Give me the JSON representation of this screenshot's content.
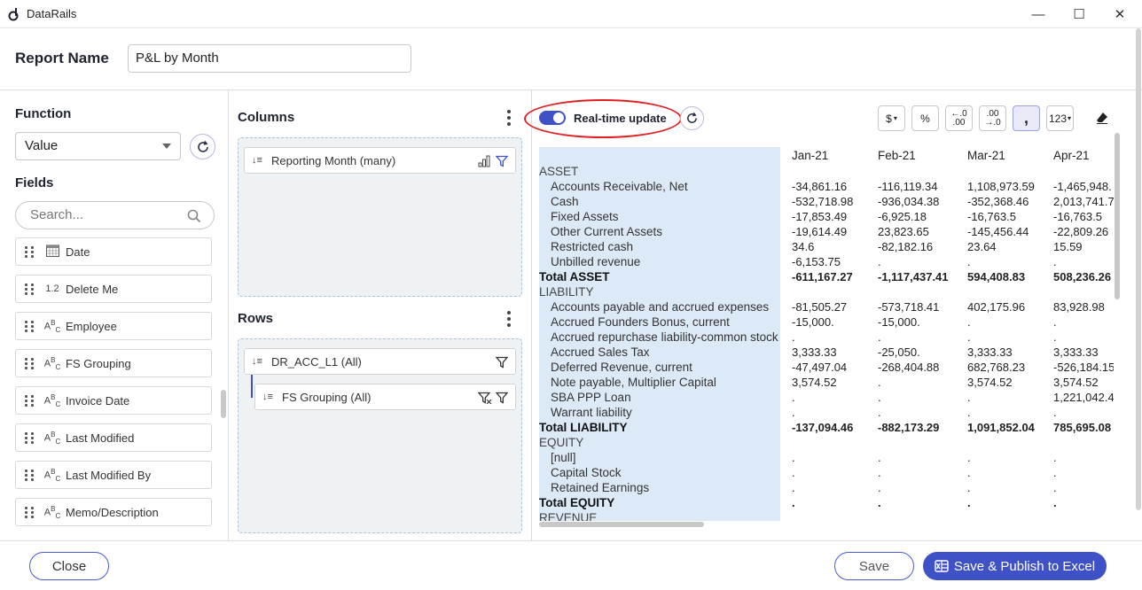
{
  "app": {
    "title": "DataRails"
  },
  "window": {
    "minimize": "—",
    "maximize": "☐",
    "close": "✕"
  },
  "report": {
    "label": "Report Name",
    "value": "P&L by Month"
  },
  "left": {
    "function_title": "Function",
    "function_value": "Value",
    "fields_title": "Fields",
    "search_placeholder": "Search...",
    "fields": [
      {
        "type": "date",
        "label": "Date"
      },
      {
        "type": "1.2",
        "label": "Delete Me"
      },
      {
        "type": "abc",
        "label": "Employee"
      },
      {
        "type": "abc",
        "label": "FS Grouping"
      },
      {
        "type": "abc",
        "label": "Invoice Date"
      },
      {
        "type": "abc",
        "label": "Last Modified"
      },
      {
        "type": "abc",
        "label": "Last Modified By"
      },
      {
        "type": "abc",
        "label": "Memo/Description"
      }
    ]
  },
  "middle": {
    "columns_title": "Columns",
    "column_pill": "Reporting Month (many)",
    "rows_title": "Rows",
    "row_pills": [
      "DR_ACC_L1 (All)",
      "FS Grouping (All)"
    ]
  },
  "right": {
    "realtime_label": "Real-time update",
    "format_buttons": [
      "$",
      "%",
      "←.0 .00",
      ".00 →.0",
      ",",
      "123"
    ],
    "grid": {
      "columns": [
        "Jan-21",
        "Feb-21",
        "Mar-21",
        "Apr-21"
      ],
      "rows": [
        {
          "label": "ASSET",
          "kind": "group",
          "values": [
            "",
            "",
            "",
            ""
          ]
        },
        {
          "label": "Accounts Receivable, Net",
          "kind": "item",
          "values": [
            "-34,861.16",
            "-116,119.34",
            "1,108,973.59",
            "-1,465,948."
          ]
        },
        {
          "label": "Cash",
          "kind": "item",
          "values": [
            "-532,718.98",
            "-936,034.38",
            "-352,368.46",
            "2,013,741.7"
          ]
        },
        {
          "label": "Fixed Assets",
          "kind": "item",
          "values": [
            "-17,853.49",
            "-6,925.18",
            "-16,763.5",
            "-16,763.5"
          ]
        },
        {
          "label": "Other Current Assets",
          "kind": "item",
          "values": [
            "-19,614.49",
            "23,823.65",
            "-145,456.44",
            "-22,809.26"
          ]
        },
        {
          "label": "Restricted cash",
          "kind": "item",
          "values": [
            "34.6",
            "-82,182.16",
            "23.64",
            "15.59"
          ]
        },
        {
          "label": "Unbilled revenue",
          "kind": "item",
          "values": [
            "-6,153.75",
            ".",
            ".",
            "."
          ]
        },
        {
          "label": "Total ASSET",
          "kind": "total",
          "values": [
            "-611,167.27",
            "-1,117,437.41",
            "594,408.83",
            "508,236.26"
          ]
        },
        {
          "label": "LIABILITY",
          "kind": "group",
          "values": [
            "",
            "",
            "",
            ""
          ]
        },
        {
          "label": "Accounts payable and accrued expenses",
          "kind": "item",
          "values": [
            "-81,505.27",
            "-573,718.41",
            "402,175.96",
            "83,928.98"
          ]
        },
        {
          "label": "Accrued Founders Bonus, current",
          "kind": "item",
          "values": [
            "-15,000.",
            "-15,000.",
            ".",
            "."
          ]
        },
        {
          "label": "Accrued repurchase liability-common stock",
          "kind": "item",
          "values": [
            ".",
            ".",
            ".",
            "."
          ]
        },
        {
          "label": "Accrued Sales Tax",
          "kind": "item",
          "values": [
            "3,333.33",
            "-25,050.",
            "3,333.33",
            "3,333.33"
          ]
        },
        {
          "label": "Deferred Revenue, current",
          "kind": "item",
          "values": [
            "-47,497.04",
            "-268,404.88",
            "682,768.23",
            "-526,184.15"
          ]
        },
        {
          "label": "Note payable, Multiplier Capital",
          "kind": "item",
          "values": [
            "3,574.52",
            ".",
            "3,574.52",
            "3,574.52"
          ]
        },
        {
          "label": "SBA PPP Loan",
          "kind": "item",
          "values": [
            ".",
            ".",
            ".",
            "1,221,042.4"
          ]
        },
        {
          "label": "Warrant liability",
          "kind": "item",
          "values": [
            ".",
            ".",
            ".",
            "."
          ]
        },
        {
          "label": "Total LIABILITY",
          "kind": "total",
          "values": [
            "-137,094.46",
            "-882,173.29",
            "1,091,852.04",
            "785,695.08"
          ]
        },
        {
          "label": "EQUITY",
          "kind": "group",
          "values": [
            "",
            "",
            "",
            ""
          ]
        },
        {
          "label": "[null]",
          "kind": "item",
          "values": [
            ".",
            ".",
            ".",
            "."
          ]
        },
        {
          "label": "Capital Stock",
          "kind": "item",
          "values": [
            ".",
            ".",
            ".",
            "."
          ]
        },
        {
          "label": "Retained Earnings",
          "kind": "item",
          "values": [
            ".",
            ".",
            ".",
            "."
          ]
        },
        {
          "label": "Total EQUITY",
          "kind": "total",
          "values": [
            ".",
            ".",
            ".",
            "."
          ]
        },
        {
          "label": "REVENUE",
          "kind": "group",
          "values": [
            "",
            "",
            "",
            ""
          ]
        }
      ]
    }
  },
  "footer": {
    "close": "Close",
    "save": "Save",
    "publish": "Save & Publish to Excel"
  },
  "colors": {
    "accent": "#3f51c6",
    "highlight": "#e02020",
    "grid_label_bg": "#dce9f6"
  }
}
